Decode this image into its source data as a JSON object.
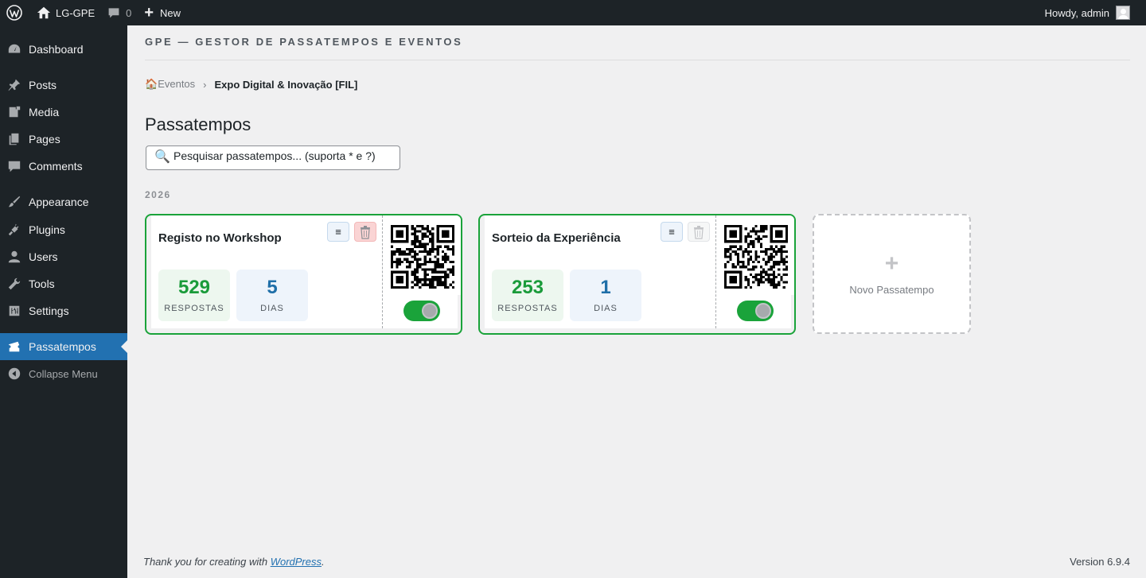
{
  "adminbar": {
    "site_name": "LG-GPE",
    "comments_count": "0",
    "new_label": "New",
    "howdy": "Howdy, admin"
  },
  "sidebar": {
    "items": [
      {
        "label": "Dashboard",
        "icon": "dashboard-icon"
      },
      {
        "label": "Posts",
        "icon": "pin-icon"
      },
      {
        "label": "Media",
        "icon": "media-icon"
      },
      {
        "label": "Pages",
        "icon": "pages-icon"
      },
      {
        "label": "Comments",
        "icon": "comment-icon"
      },
      {
        "label": "Appearance",
        "icon": "brush-icon"
      },
      {
        "label": "Plugins",
        "icon": "plug-icon"
      },
      {
        "label": "Users",
        "icon": "user-icon"
      },
      {
        "label": "Tools",
        "icon": "wrench-icon"
      },
      {
        "label": "Settings",
        "icon": "settings-icon"
      },
      {
        "label": "Passatempos",
        "icon": "ticket-icon",
        "active": true
      },
      {
        "label": "Collapse Menu",
        "icon": "collapse-icon"
      }
    ]
  },
  "main": {
    "plugin_header": "GPE — GESTOR DE PASSATEMPOS E EVENTOS",
    "breadcrumb": {
      "home_icon": "🏠",
      "home": "Eventos",
      "separator": "›",
      "current": "Expo Digital & Inovação [FIL]"
    },
    "title": "Passatempos",
    "search": {
      "icon": "🔍",
      "placeholder": "Pesquisar passatempos... (suporta * e ?)"
    },
    "year": "2026",
    "cards": [
      {
        "title": "Registo no Workshop",
        "list_icon": "≡",
        "responses": "529",
        "responses_label": "RESPOSTAS",
        "days": "5",
        "days_label": "DIAS",
        "active": true
      },
      {
        "title": "Sorteio da Experiência",
        "list_icon": "≡",
        "responses": "253",
        "responses_label": "RESPOSTAS",
        "days": "1",
        "days_label": "DIAS",
        "active": true
      }
    ],
    "new_card": {
      "plus": "+",
      "label": "Novo Passatempo"
    }
  },
  "footer": {
    "thanks_prefix": "Thank you for creating with ",
    "thanks_link": "WordPress",
    "thanks_suffix": ".",
    "version": "Version 6.9.4"
  },
  "colors": {
    "accent": "#2271b1",
    "card_border": "#1aa33a",
    "responses_color": "#1a9b3a",
    "days_color": "#1f6fa8",
    "sidebar_bg": "#1d2327"
  }
}
